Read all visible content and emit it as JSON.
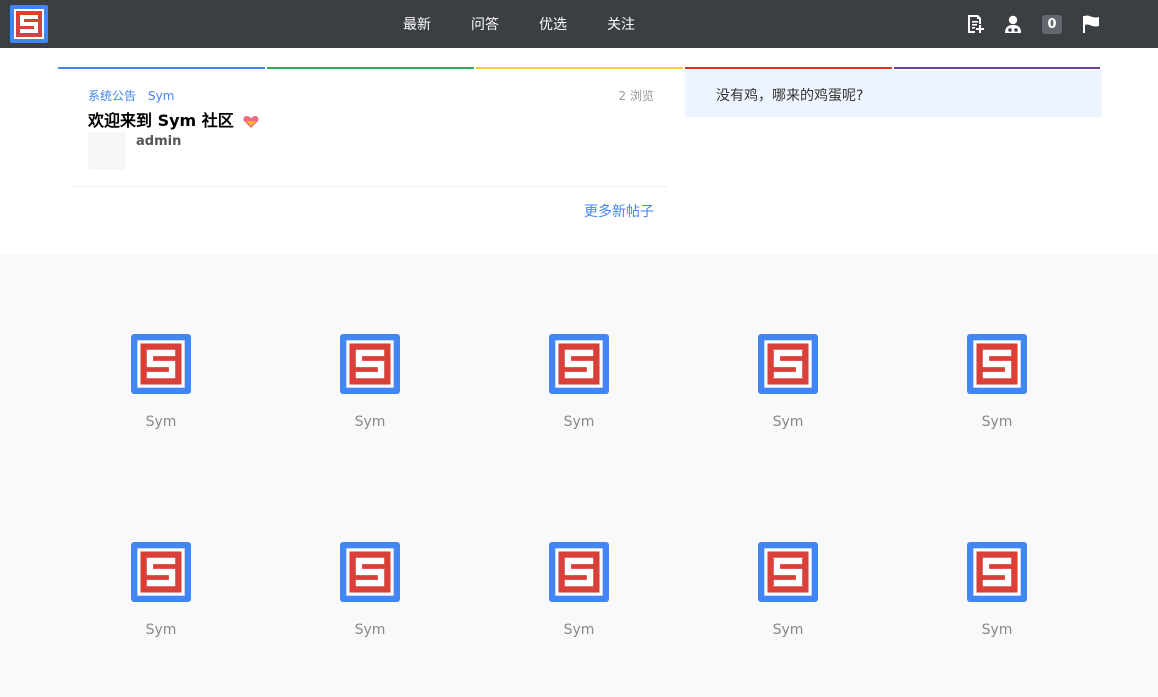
{
  "nav": {
    "items": [
      {
        "label": "最新"
      },
      {
        "label": "问答"
      },
      {
        "label": "优选"
      },
      {
        "label": "关注"
      }
    ]
  },
  "header": {
    "icons": [
      "new-post-icon",
      "user-icon",
      "notification-count",
      "flag-icon"
    ],
    "notification_count": "0"
  },
  "accent_bars": [
    "#4285f4",
    "#34a853",
    "#f4d03f",
    "#d93025",
    "#6a3f9e"
  ],
  "post": {
    "tags": [
      "系统公告",
      "Sym"
    ],
    "views": "2 浏览",
    "title": "欢迎来到 Sym 社区",
    "author": "admin",
    "more_link": "更多新帖子"
  },
  "sidebar": {
    "quote": "没有鸡，哪来的鸡蛋呢?"
  },
  "tiles": [
    {
      "label": "Sym"
    },
    {
      "label": "Sym"
    },
    {
      "label": "Sym"
    },
    {
      "label": "Sym"
    },
    {
      "label": "Sym"
    },
    {
      "label": "Sym"
    },
    {
      "label": "Sym"
    },
    {
      "label": "Sym"
    },
    {
      "label": "Sym"
    },
    {
      "label": "Sym"
    }
  ],
  "colors": {
    "topbar": "#3b3e43",
    "brand_blue": "#4285f4",
    "brand_red": "#d9403a"
  }
}
